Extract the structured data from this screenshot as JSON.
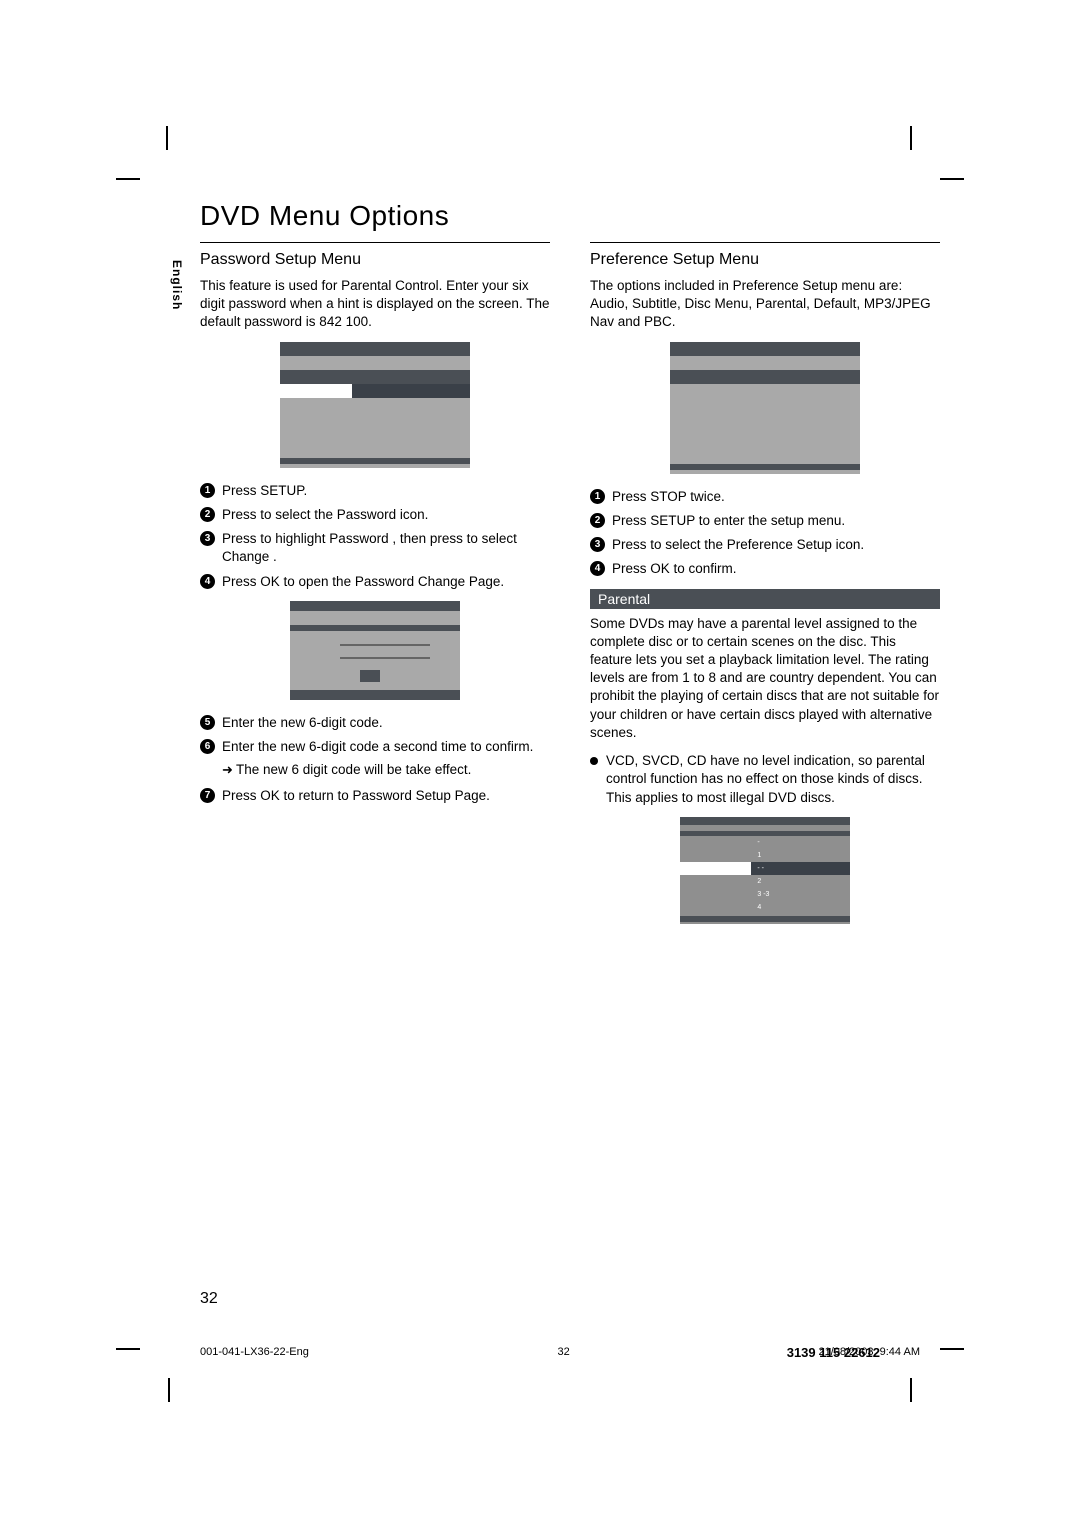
{
  "language_tab": "English",
  "title": "DVD Menu Options",
  "left": {
    "heading": "Password Setup Menu",
    "intro": "This feature is used for Parental Control. Enter your six digit password when a hint is displayed on the screen. The default password is 842 100.",
    "steps_a": [
      "Press SETUP.",
      "Press      to select the Password  icon.",
      "Press     to highlight  Password , then press     to select  Change .",
      "Press OK  to open the Password Change Page."
    ],
    "steps_b": [
      "Enter the new 6-digit code.",
      "Enter the new 6-digit code a second time to confirm."
    ],
    "arrow_note": "The new 6 digit code will be take effect.",
    "steps_c": [
      "Press OK  to return to Password Setup Page."
    ]
  },
  "right": {
    "heading": "Preference Setup Menu",
    "intro": "The options included in Preference Setup menu are: Audio, Subtitle, Disc Menu, Parental, Default, MP3/JPEG Nav and PBC.",
    "steps": [
      "Press STOP  twice.",
      "Press SETUP  to enter the setup menu.",
      "Press      to select the Preference Setup icon.",
      "Press OK  to confirm."
    ],
    "sub_heading": "Parental",
    "sub_para": "Some DVDs may have a parental level assigned to the complete disc or to certain scenes on the disc.  This feature lets you set a playback limitation level. The rating levels are from 1 to 8 and are country dependent.  You can prohibit the playing of certain discs that are not suitable for your children or have certain discs played with alternative scenes.",
    "sub_bullet": "VCD, SVCD, CD have no level indication, so parental control function has no effect on those kinds of discs. This applies to most illegal DVD discs.",
    "osd3_rows": [
      "-",
      "1",
      "-   -",
      "2",
      "3   -3",
      "4"
    ]
  },
  "page_number": "32",
  "footer": {
    "left": "001-041-LX36-22-Eng",
    "mid": "32",
    "right_date": "21/08/2003, 9:44 AM",
    "right_code": "3139 115 22612"
  }
}
